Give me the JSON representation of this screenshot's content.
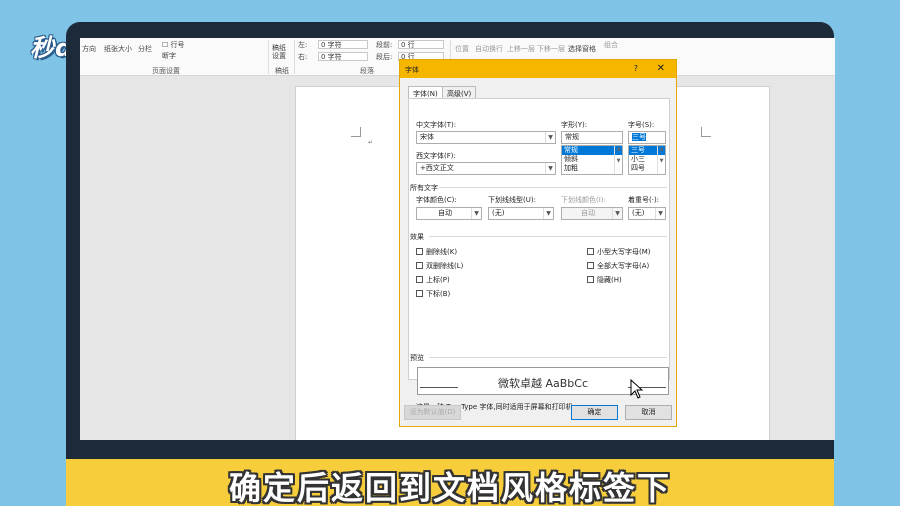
{
  "logo": {
    "text": "秒dong视频"
  },
  "ribbon": {
    "items": [
      "方向",
      "纸张大小",
      "分栏",
      "行号",
      "断字",
      "稿纸设置",
      "位置",
      "自动换行",
      "上移一层",
      "下移一层",
      "选择窗格",
      "组合"
    ],
    "indent_left_label": "左:",
    "indent_left_value": "0 字符",
    "indent_right_label": "右:",
    "indent_right_value": "0 字符",
    "spacing_before_label": "段前:",
    "spacing_before_value": "0 行",
    "spacing_after_label": "段后:",
    "spacing_after_value": "0 行",
    "groups": [
      "页面设置",
      "稿纸",
      "段落"
    ]
  },
  "dialog": {
    "title": "字体",
    "help": "?",
    "close": "✕",
    "tabs": [
      "字体(N)",
      "高级(V)"
    ],
    "chinese_font_label": "中文字体(T):",
    "chinese_font_value": "宋体",
    "western_font_label": "西文字体(F):",
    "western_font_value": "+西文正文",
    "style_label": "字形(Y):",
    "style_value": "常规",
    "style_options": [
      "常规",
      "倾斜",
      "加粗"
    ],
    "size_label": "字号(S):",
    "size_value": "三号",
    "size_options": [
      "三号",
      "小三",
      "四号"
    ],
    "all_text_head": "所有文字",
    "font_color_label": "字体颜色(C):",
    "font_color_value": "自动",
    "underline_label": "下划线线型(U):",
    "underline_value": "(无)",
    "underline_color_label": "下划线颜色(I):",
    "underline_color_value": "自动",
    "emphasis_label": "着重号(·):",
    "emphasis_value": "(无)",
    "effects_head": "效果",
    "effects_left": [
      "删除线(K)",
      "双删除线(L)",
      "上标(P)",
      "下标(B)"
    ],
    "effects_right": [
      "小型大写字母(M)",
      "全部大写字母(A)",
      "隐藏(H)"
    ],
    "preview_head": "预览",
    "preview_text": "微软卓越  AaBbCc",
    "preview_note": "这是一种 TrueType 字体,同时适用于屏幕和打印机。",
    "set_default": "设为默认值(D)",
    "ok": "确定",
    "cancel": "取消"
  },
  "caption": {
    "text": "确定后返回到文档风格标签下"
  }
}
